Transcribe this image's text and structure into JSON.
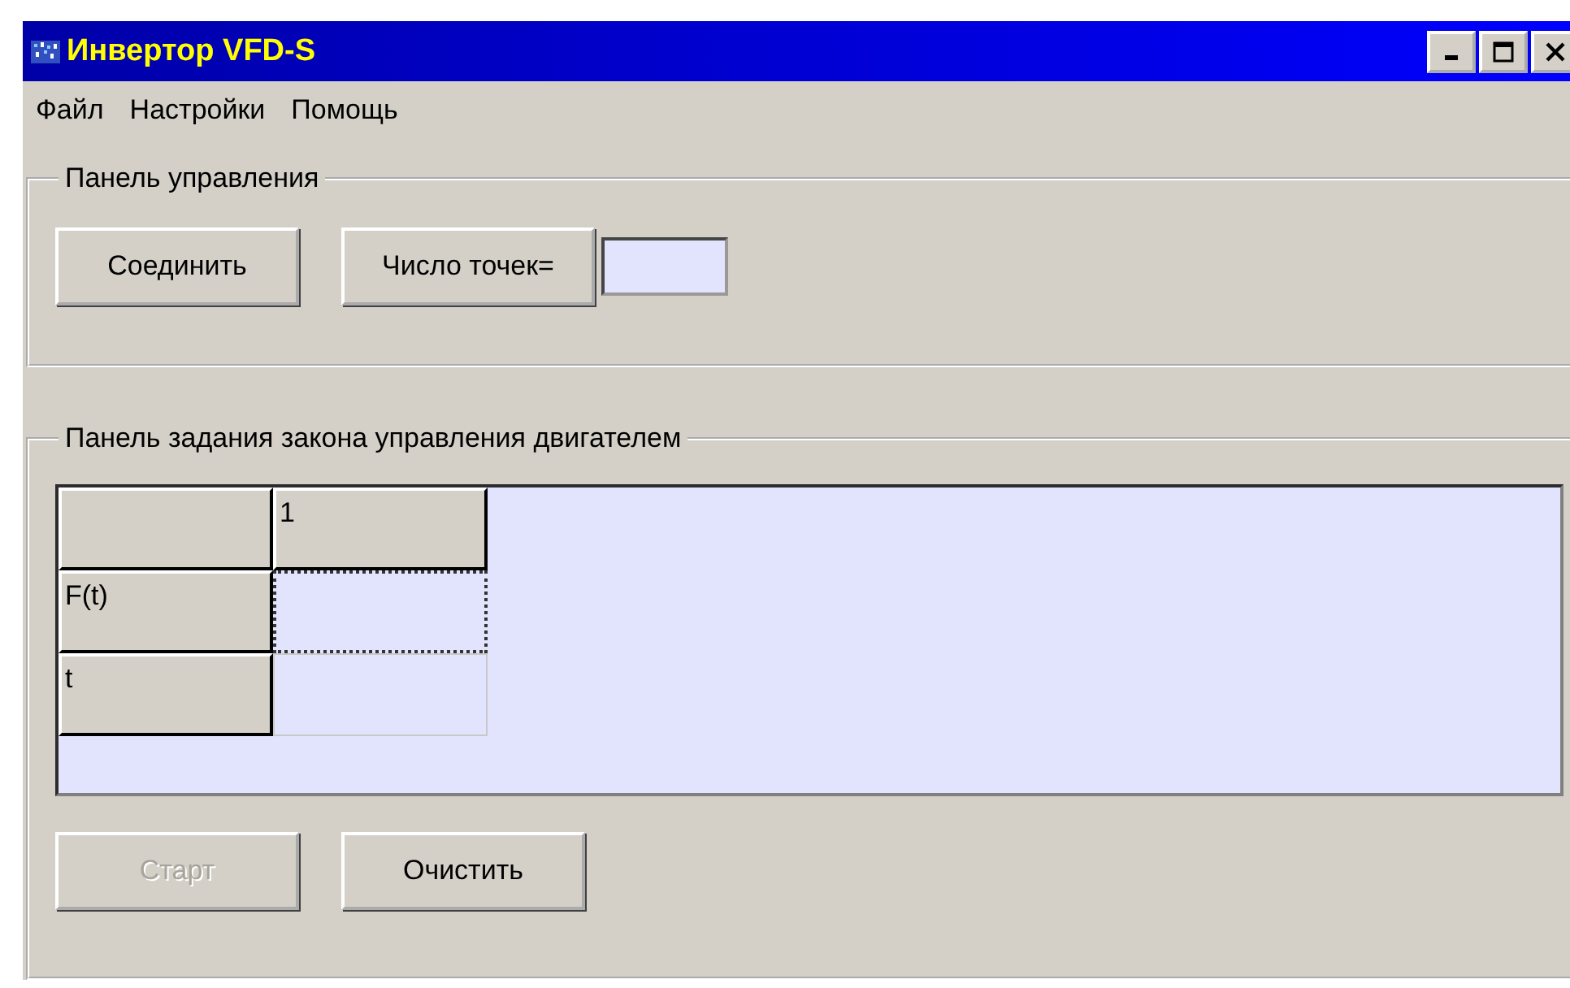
{
  "window": {
    "title": "Инвертор VFD-S"
  },
  "menu": [
    "Файл",
    "Настройки",
    "Помощь"
  ],
  "control_panel": {
    "title": "Панель управления",
    "connect_button": "Соединить",
    "points_button": "Число точек="
  },
  "law_panel": {
    "title": "Панель задания закона управления двигателем",
    "grid": {
      "columns": [
        "1"
      ],
      "rows": [
        {
          "header": "F(t)",
          "cells": [
            {
              "focused": true
            }
          ]
        },
        {
          "header": "t",
          "cells": [
            {
              "focused": false
            }
          ]
        }
      ]
    },
    "buttons": [
      {
        "label": "Старт",
        "disabled": true
      },
      {
        "label": "Очистить",
        "disabled": false
      }
    ]
  }
}
